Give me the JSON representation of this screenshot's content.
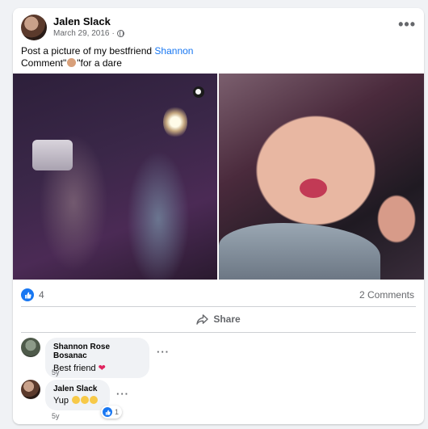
{
  "post": {
    "author": "Jalen Slack",
    "date": "March 29, 2016",
    "separator": "·",
    "privacy_icon": "globe-icon",
    "text_line1_prefix": "Post a picture of my bestfriend ",
    "mention": "Shannon",
    "text_line2_prefix": "Comment\"",
    "text_line2_suffix": "\"for a dare",
    "more_icon": "•••"
  },
  "photos": [
    {
      "name": "bathroom-mirror-selfie"
    },
    {
      "name": "kissy-face-selfie"
    }
  ],
  "reactions": {
    "like_count": "4",
    "comment_count": "2 Comments"
  },
  "actions": {
    "share_label": "Share"
  },
  "comments": [
    {
      "author": "Shannon Rose Bosanac",
      "text": "Best friend",
      "emoji": "heart",
      "time": "5y"
    },
    {
      "author": "Jalen Slack",
      "text": "Yup",
      "emoji": "grinning-faces",
      "time": "5y",
      "reaction_count": "1"
    }
  ],
  "colors": {
    "accent": "#1877f2",
    "background": "#f0f2f5",
    "secondary_text": "#65676b"
  }
}
